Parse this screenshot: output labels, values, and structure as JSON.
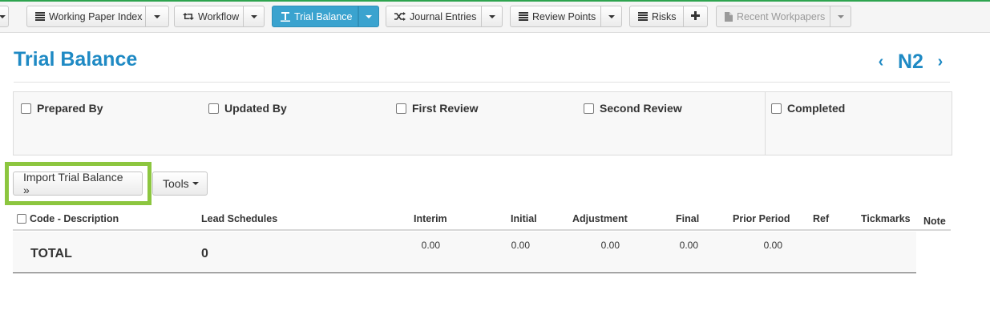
{
  "toolbar": {
    "working_paper_index": "Working Paper Index",
    "workflow": "Workflow",
    "trial_balance": "Trial Balance",
    "journal_entries": "Journal Entries",
    "review_points": "Review Points",
    "risks": "Risks",
    "recent_workpapers": "Recent Workpapers"
  },
  "page": {
    "title": "Trial Balance",
    "nav_label": "N2"
  },
  "signoffs": [
    "Prepared By",
    "Updated By",
    "First Review",
    "Second Review",
    "Completed"
  ],
  "buttons": {
    "import": "Import Trial Balance »",
    "tools": "Tools"
  },
  "table": {
    "columns": [
      "Code - Description",
      "Lead Schedules",
      "Interim",
      "Initial",
      "Adjustment",
      "Final",
      "Prior Period",
      "Ref",
      "Tickmarks",
      "Note"
    ],
    "total": {
      "label": "TOTAL",
      "count": "0",
      "interim": "0.00",
      "initial": "0.00",
      "adjustment": "0.00",
      "final": "0.00",
      "prior_period": "0.00"
    }
  },
  "colors": {
    "accent": "#1f8ac4",
    "active_tab": "#3aa3cf",
    "highlight": "#8cc63f",
    "top_line": "#2ea44f"
  }
}
